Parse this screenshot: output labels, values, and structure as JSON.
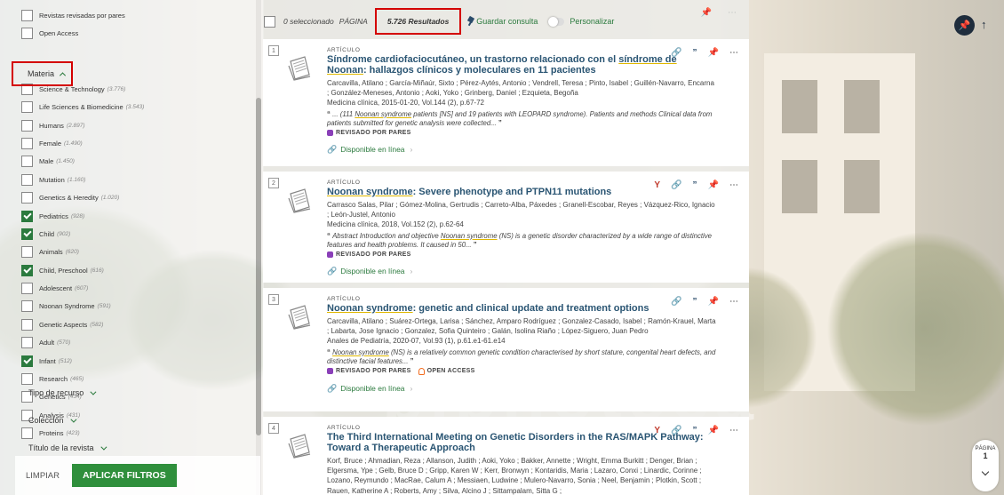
{
  "sidebar": {
    "top_facets": [
      {
        "label": "Revistas revisadas por pares",
        "count": "",
        "checked": false
      },
      {
        "label": "Open Access",
        "count": "",
        "checked": false
      }
    ],
    "materia_label": "Materia",
    "materia_facets": [
      {
        "label": "Science & Technology",
        "count": "(3.776)",
        "checked": false
      },
      {
        "label": "Life Sciences & Biomedicine",
        "count": "(3.543)",
        "checked": false
      },
      {
        "label": "Humans",
        "count": "(2.897)",
        "checked": false
      },
      {
        "label": "Female",
        "count": "(1.490)",
        "checked": false
      },
      {
        "label": "Male",
        "count": "(1.450)",
        "checked": false
      },
      {
        "label": "Mutation",
        "count": "(1.160)",
        "checked": false
      },
      {
        "label": "Genetics & Heredity",
        "count": "(1.020)",
        "checked": false
      },
      {
        "label": "Pediatrics",
        "count": "(928)",
        "checked": true
      },
      {
        "label": "Child",
        "count": "(902)",
        "checked": true
      },
      {
        "label": "Animals",
        "count": "(620)",
        "checked": false
      },
      {
        "label": "Child, Preschool",
        "count": "(616)",
        "checked": true
      },
      {
        "label": "Adolescent",
        "count": "(607)",
        "checked": false
      },
      {
        "label": "Noonan Syndrome",
        "count": "(591)",
        "checked": false
      },
      {
        "label": "Genetic Aspects",
        "count": "(582)",
        "checked": false
      },
      {
        "label": "Adult",
        "count": "(570)",
        "checked": false
      },
      {
        "label": "Infant",
        "count": "(512)",
        "checked": true
      },
      {
        "label": "Research",
        "count": "(465)",
        "checked": false
      },
      {
        "label": "Genetics",
        "count": "(434)",
        "checked": false
      },
      {
        "label": "Analysis",
        "count": "(431)",
        "checked": false
      },
      {
        "label": "Proteins",
        "count": "(423)",
        "checked": false
      }
    ],
    "groups": {
      "tipo_recurso": "Tipo de recurso",
      "coleccion": "Colección",
      "titulo_revista": "Título de la revista"
    },
    "buttons": {
      "limpiar": "LIMPIAR",
      "aplicar": "APLICAR FILTROS"
    }
  },
  "toolbar": {
    "selected": "0 seleccionado",
    "pagina": "PÁGINA",
    "results": "5.726 Resultados",
    "guardar": "Guardar consulta",
    "personalizar": "Personalizar"
  },
  "results": [
    {
      "index": "1",
      "type": "ARTÍCULO",
      "title_pre": "Síndrome cardiofaciocutáneo, un trastorno relacionado con el ",
      "title_hl": "síndrome de Noonan",
      "title_post": ": hallazgos clínicos y moleculares en 11 pacientes",
      "authors": "Carcavilla, Atilano ; García-Miñaúr, Sixto ; Pérez-Aytés, Antonio ; Vendrell, Teresa ; Pinto, Isabel ; Guillén-Navarro, Encarna ; González-Meneses, Antonio ; Aoki, Yoko ; Grinberg, Daniel ; Ezquieta, Begoña",
      "source": "Medicina clínica, 2015-01-20, Vol.144 (2), p.67-72",
      "snippet_pre": "... (111 ",
      "snippet_hl": "Noonan syndrome",
      "snippet_post": " patients [NS] and 19 patients with LEOPARD syndrome). Patients and methods Clinical data from patients submitted for genetic analysis were collected...",
      "peer": "REVISADO POR PARES",
      "oa": "",
      "available": "Disponible en línea"
    },
    {
      "index": "2",
      "type": "ARTÍCULO",
      "title_pre": "",
      "title_hl": "Noonan syndrome",
      "title_post": ": Severe phenotype and PTPN11 mutations",
      "authors": "Carrasco Salas, Pilar ; Gómez-Molina, Gertrudis ; Carreto-Alba, Páxedes ; Granell-Escobar, Reyes ; Vázquez-Rico, Ignacio ; León-Justel, Antonio",
      "source": "Medicina clínica, 2018, Vol.152 (2), p.62-64",
      "snippet_pre": "Abstract Introduction and objective ",
      "snippet_hl": "Noonan syndrome",
      "snippet_post": " (NS) is a genetic disorder characterized by a wide range of distinctive features and health problems. It caused in 50...",
      "peer": "REVISADO POR PARES",
      "oa": "",
      "available": "Disponible en línea"
    },
    {
      "index": "3",
      "type": "ARTÍCULO",
      "title_pre": "",
      "title_hl": "Noonan syndrome",
      "title_post": ": genetic and clinical update and treatment options",
      "authors": "Carcavilla, Atilano ; Suárez-Ortega, Larisa ; Sánchez, Amparo Rodríguez ; Gonzalez-Casado, Isabel ; Ramón-Krauel, Marta ; Labarta, Jose Ignacio ; Gonzalez, Sofia Quinteiro ; Galán, Isolina Riaño ; López-Siguero, Juan Pedro",
      "source": "Anales de Pediatría, 2020-07, Vol.93 (1), p.61.e1-61.e14",
      "snippet_pre": "",
      "snippet_hl": "Noonan syndrome",
      "snippet_post": " (NS) is a relatively common genetic condition characterised by short stature, congenital heart defects, and distinctive facial features...",
      "peer": "REVISADO POR PARES",
      "oa": "OPEN ACCESS",
      "available": "Disponible en línea"
    },
    {
      "index": "4",
      "type": "ARTÍCULO",
      "title_pre": "The Third International Meeting on Genetic Disorders in the RAS/MAPK Pathway: Toward a Therapeutic Approach",
      "title_hl": "",
      "title_post": "",
      "authors": "Korf, Bruce ; Ahmadian, Reza ; Allanson, Judith ; Aoki, Yoko ; Bakker, Annette ; Wright, Emma Burkitt ; Denger, Brian ; Elgersma, Ype ; Gelb, Bruce D ; Gripp, Karen W ; Kerr, Bronwyn ; Kontaridis, Maria ; Lazaro, Conxi ; Linardic, Corinne ; Lozano, Reymundo ; MacRae, Calum A ; Messiaen, Ludwine ; Mulero-Navarro, Sonia ; Neel, Benjamin ; Plotkin, Scott ; Rauen, Katherine A ; Roberts, Amy ; Silva, Alcino J ; Sittampalam, Sitta G ;",
      "source": "",
      "snippet_pre": "",
      "snippet_hl": "",
      "snippet_post": "",
      "peer": "",
      "oa": "",
      "available": ""
    }
  ],
  "right": {
    "page_label": "PÁGINA",
    "page_number": "1"
  }
}
